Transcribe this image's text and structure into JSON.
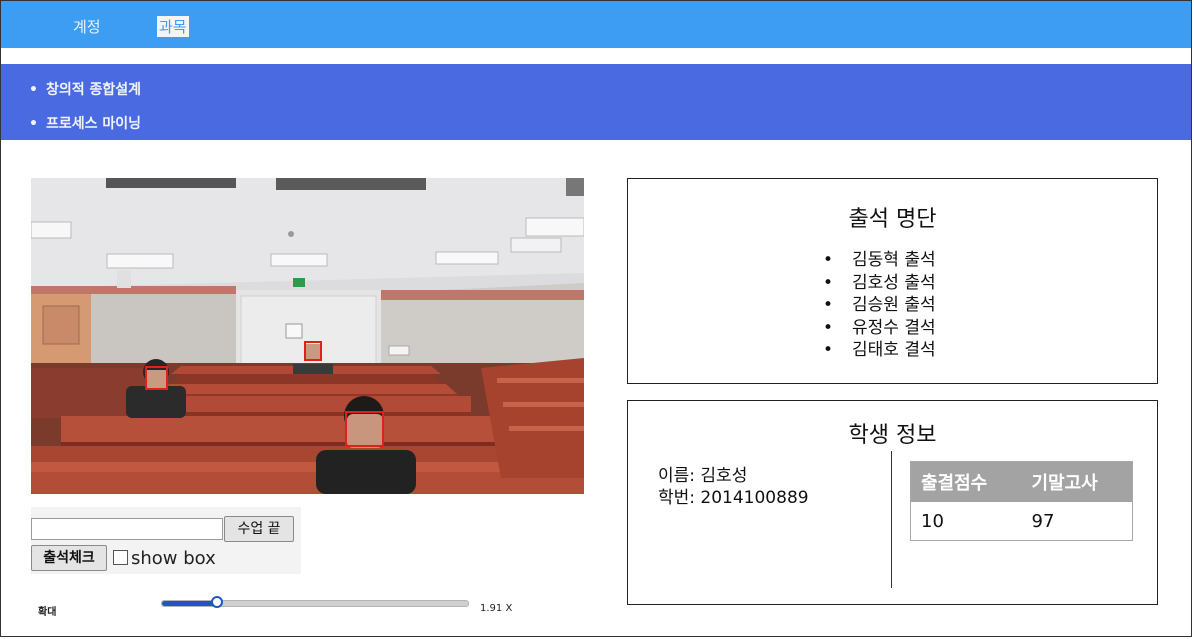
{
  "topnav": {
    "tabs": [
      {
        "label": "계정",
        "active": false
      },
      {
        "label": "과목",
        "active": true
      }
    ]
  },
  "subjects": [
    "창의적 종합설계",
    "프로세스 마이닝"
  ],
  "controls": {
    "end_class_label": "수업 끝",
    "attendance_check_label": "출석체크",
    "show_box_label": "show box",
    "show_box_checked": false,
    "text_value": ""
  },
  "zoom": {
    "label": "확대",
    "value_text": "1.91 X",
    "slider_fraction": 0.18
  },
  "attendance": {
    "title": "출석 명단",
    "entries": [
      "김동혁 출석",
      "김호성 출석",
      "김승원 출석",
      "유정수 결석",
      "김태호 결석"
    ]
  },
  "student_info": {
    "title": "학생 정보",
    "name_line": "이름: 김호성",
    "id_line": "학번: 2014100889",
    "table": {
      "headers": [
        "출결점수",
        "기말고사"
      ],
      "row": [
        "10",
        "97"
      ]
    }
  },
  "colors": {
    "topnav": "#3d9df2",
    "subnav": "#4a6ae2",
    "slider": "#1e56c6",
    "face_box": "#e0201a"
  }
}
